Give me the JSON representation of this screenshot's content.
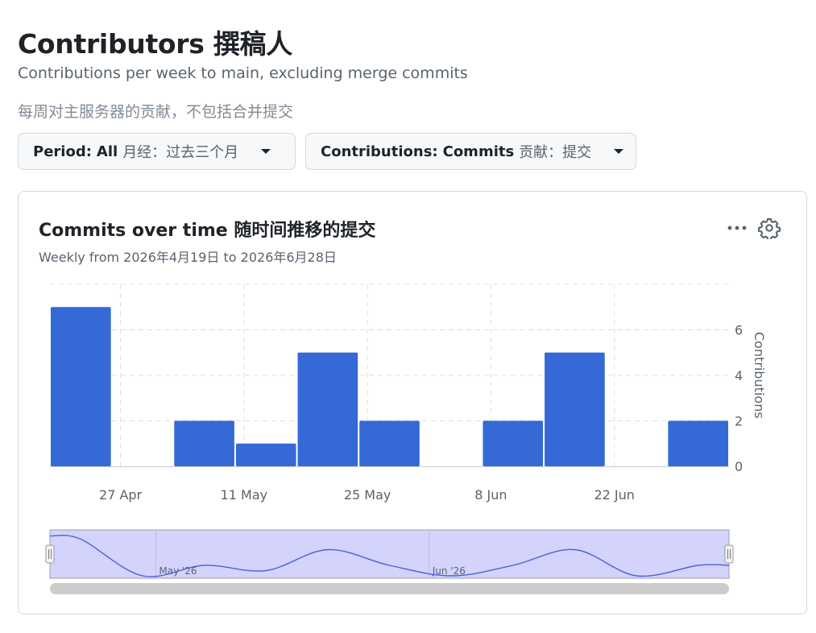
{
  "header": {
    "title": "Contributors 撰稿人",
    "subtitle_en": "Contributions per week to main, excluding merge commits",
    "subtitle_zh": "每周对主服务器的贡献，不包括合并提交"
  },
  "filters": {
    "period": {
      "key": "Period:",
      "value": "All",
      "value_zh": "月经：过去三个月"
    },
    "contributions": {
      "key": "Contributions:",
      "value": "Commits",
      "value_zh": "贡献：提交"
    }
  },
  "card": {
    "title": "Commits over time 随时间推移的提交",
    "subtitle": "Weekly from 2026年4月19日 to 2026年6月28日",
    "menu_icon": "kebab-horizontal-icon",
    "settings_icon": "gear-icon"
  },
  "colors": {
    "bar": "#3469d6",
    "navigator_fill": "#d3d3fb",
    "navigator_line": "#4a62d8",
    "scrollbar": "#cccccc"
  },
  "chart_data": {
    "type": "bar",
    "x": [
      "2026-04-19",
      "2026-04-26",
      "2026-05-03",
      "2026-05-10",
      "2026-05-17",
      "2026-05-24",
      "2026-05-31",
      "2026-06-07",
      "2026-06-14",
      "2026-06-21",
      "2026-06-28"
    ],
    "values": [
      7,
      0,
      2,
      1,
      5,
      2,
      0,
      2,
      5,
      0,
      2
    ],
    "xticks": [
      "27 Apr",
      "11 May",
      "25 May",
      "8 Jun",
      "22 Jun"
    ],
    "yticks": [
      0,
      2,
      4,
      6
    ],
    "ylim": [
      0,
      8
    ],
    "ylabel": "Contributions",
    "grid": true,
    "navigator": {
      "labels": [
        "May '26",
        "Jun '26"
      ]
    }
  }
}
